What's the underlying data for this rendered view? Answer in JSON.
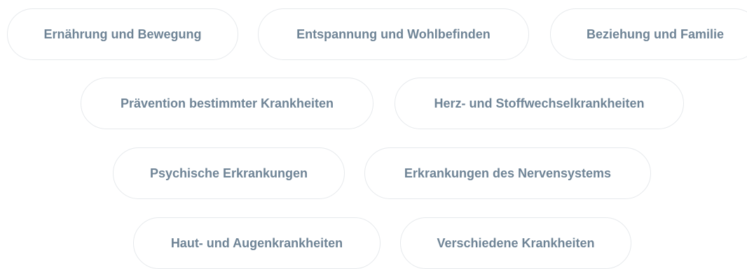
{
  "topics": [
    {
      "label": "Ernährung und Bewegung"
    },
    {
      "label": "Entspannung und Wohlbefinden"
    },
    {
      "label": "Beziehung und Familie"
    },
    {
      "label": "Prävention bestimmter Krankheiten"
    },
    {
      "label": "Herz- und Stoffwechselkrankheiten"
    },
    {
      "label": "Psychische Erkrankungen"
    },
    {
      "label": "Erkrankungen des Nervensystems"
    },
    {
      "label": "Haut- und Augenkrankheiten"
    },
    {
      "label": "Verschiedene Krankheiten"
    }
  ],
  "colors": {
    "text": "#6f8496",
    "border": "#e6e9ec",
    "background": "#ffffff"
  }
}
